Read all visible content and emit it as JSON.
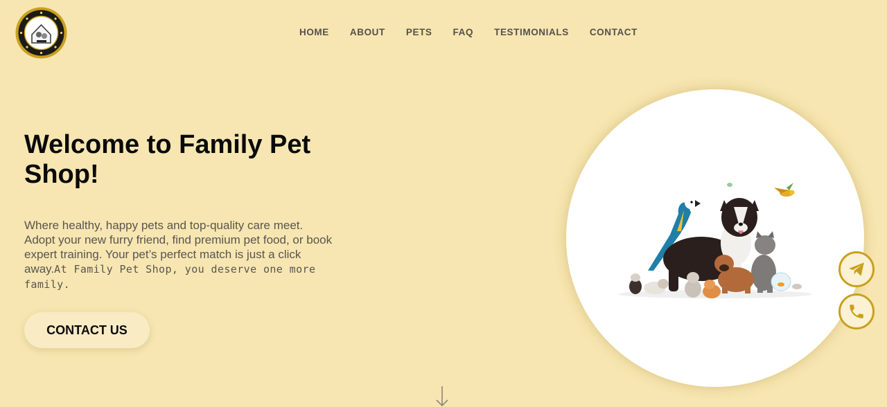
{
  "header": {
    "logo_icon": "pet-shop-logo-icon",
    "nav": [
      {
        "label": "HOME"
      },
      {
        "label": "ABOUT"
      },
      {
        "label": "PETS"
      },
      {
        "label": "FAQ"
      },
      {
        "label": "TESTIMONIALS"
      },
      {
        "label": "CONTACT"
      }
    ]
  },
  "hero": {
    "title": "Welcome to Family Pet Shop!",
    "description": "Where healthy, happy pets and top-quality care meet. Adopt your new furry friend, find premium pet food, or book expert training. Your pet’s perfect match is just a click away.",
    "description_mono": "At Family Pet Shop, you deserve one more family.",
    "cta_label": "CONTACT US",
    "image_icon": "pets-group-image"
  },
  "floating": {
    "telegram_icon": "telegram-icon",
    "phone_icon": "phone-icon"
  },
  "scroll": {
    "icon": "arrow-down-icon"
  },
  "colors": {
    "background": "#f7e6b1",
    "accent_gold": "#c9a01e",
    "text_dark": "#0a0a0a",
    "text_muted": "#58554f"
  }
}
